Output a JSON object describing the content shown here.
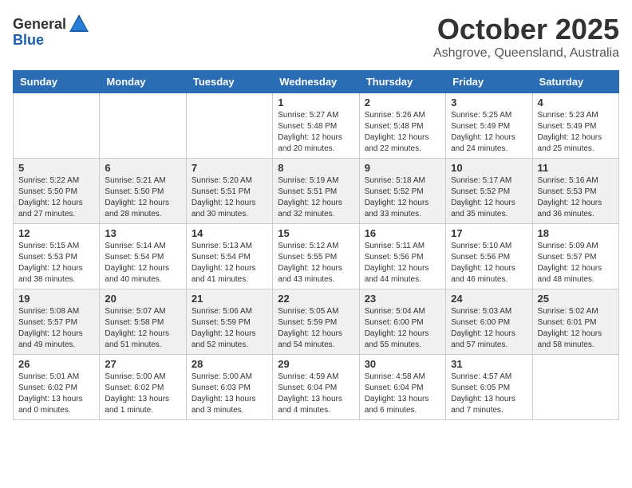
{
  "logo": {
    "general": "General",
    "blue": "Blue"
  },
  "title": "October 2025",
  "location": "Ashgrove, Queensland, Australia",
  "days_of_week": [
    "Sunday",
    "Monday",
    "Tuesday",
    "Wednesday",
    "Thursday",
    "Friday",
    "Saturday"
  ],
  "weeks": [
    [
      {
        "day": "",
        "info": ""
      },
      {
        "day": "",
        "info": ""
      },
      {
        "day": "",
        "info": ""
      },
      {
        "day": "1",
        "info": "Sunrise: 5:27 AM\nSunset: 5:48 PM\nDaylight: 12 hours\nand 20 minutes."
      },
      {
        "day": "2",
        "info": "Sunrise: 5:26 AM\nSunset: 5:48 PM\nDaylight: 12 hours\nand 22 minutes."
      },
      {
        "day": "3",
        "info": "Sunrise: 5:25 AM\nSunset: 5:49 PM\nDaylight: 12 hours\nand 24 minutes."
      },
      {
        "day": "4",
        "info": "Sunrise: 5:23 AM\nSunset: 5:49 PM\nDaylight: 12 hours\nand 25 minutes."
      }
    ],
    [
      {
        "day": "5",
        "info": "Sunrise: 5:22 AM\nSunset: 5:50 PM\nDaylight: 12 hours\nand 27 minutes."
      },
      {
        "day": "6",
        "info": "Sunrise: 5:21 AM\nSunset: 5:50 PM\nDaylight: 12 hours\nand 28 minutes."
      },
      {
        "day": "7",
        "info": "Sunrise: 5:20 AM\nSunset: 5:51 PM\nDaylight: 12 hours\nand 30 minutes."
      },
      {
        "day": "8",
        "info": "Sunrise: 5:19 AM\nSunset: 5:51 PM\nDaylight: 12 hours\nand 32 minutes."
      },
      {
        "day": "9",
        "info": "Sunrise: 5:18 AM\nSunset: 5:52 PM\nDaylight: 12 hours\nand 33 minutes."
      },
      {
        "day": "10",
        "info": "Sunrise: 5:17 AM\nSunset: 5:52 PM\nDaylight: 12 hours\nand 35 minutes."
      },
      {
        "day": "11",
        "info": "Sunrise: 5:16 AM\nSunset: 5:53 PM\nDaylight: 12 hours\nand 36 minutes."
      }
    ],
    [
      {
        "day": "12",
        "info": "Sunrise: 5:15 AM\nSunset: 5:53 PM\nDaylight: 12 hours\nand 38 minutes."
      },
      {
        "day": "13",
        "info": "Sunrise: 5:14 AM\nSunset: 5:54 PM\nDaylight: 12 hours\nand 40 minutes."
      },
      {
        "day": "14",
        "info": "Sunrise: 5:13 AM\nSunset: 5:54 PM\nDaylight: 12 hours\nand 41 minutes."
      },
      {
        "day": "15",
        "info": "Sunrise: 5:12 AM\nSunset: 5:55 PM\nDaylight: 12 hours\nand 43 minutes."
      },
      {
        "day": "16",
        "info": "Sunrise: 5:11 AM\nSunset: 5:56 PM\nDaylight: 12 hours\nand 44 minutes."
      },
      {
        "day": "17",
        "info": "Sunrise: 5:10 AM\nSunset: 5:56 PM\nDaylight: 12 hours\nand 46 minutes."
      },
      {
        "day": "18",
        "info": "Sunrise: 5:09 AM\nSunset: 5:57 PM\nDaylight: 12 hours\nand 48 minutes."
      }
    ],
    [
      {
        "day": "19",
        "info": "Sunrise: 5:08 AM\nSunset: 5:57 PM\nDaylight: 12 hours\nand 49 minutes."
      },
      {
        "day": "20",
        "info": "Sunrise: 5:07 AM\nSunset: 5:58 PM\nDaylight: 12 hours\nand 51 minutes."
      },
      {
        "day": "21",
        "info": "Sunrise: 5:06 AM\nSunset: 5:59 PM\nDaylight: 12 hours\nand 52 minutes."
      },
      {
        "day": "22",
        "info": "Sunrise: 5:05 AM\nSunset: 5:59 PM\nDaylight: 12 hours\nand 54 minutes."
      },
      {
        "day": "23",
        "info": "Sunrise: 5:04 AM\nSunset: 6:00 PM\nDaylight: 12 hours\nand 55 minutes."
      },
      {
        "day": "24",
        "info": "Sunrise: 5:03 AM\nSunset: 6:00 PM\nDaylight: 12 hours\nand 57 minutes."
      },
      {
        "day": "25",
        "info": "Sunrise: 5:02 AM\nSunset: 6:01 PM\nDaylight: 12 hours\nand 58 minutes."
      }
    ],
    [
      {
        "day": "26",
        "info": "Sunrise: 5:01 AM\nSunset: 6:02 PM\nDaylight: 13 hours\nand 0 minutes."
      },
      {
        "day": "27",
        "info": "Sunrise: 5:00 AM\nSunset: 6:02 PM\nDaylight: 13 hours\nand 1 minute."
      },
      {
        "day": "28",
        "info": "Sunrise: 5:00 AM\nSunset: 6:03 PM\nDaylight: 13 hours\nand 3 minutes."
      },
      {
        "day": "29",
        "info": "Sunrise: 4:59 AM\nSunset: 6:04 PM\nDaylight: 13 hours\nand 4 minutes."
      },
      {
        "day": "30",
        "info": "Sunrise: 4:58 AM\nSunset: 6:04 PM\nDaylight: 13 hours\nand 6 minutes."
      },
      {
        "day": "31",
        "info": "Sunrise: 4:57 AM\nSunset: 6:05 PM\nDaylight: 13 hours\nand 7 minutes."
      },
      {
        "day": "",
        "info": ""
      }
    ]
  ]
}
